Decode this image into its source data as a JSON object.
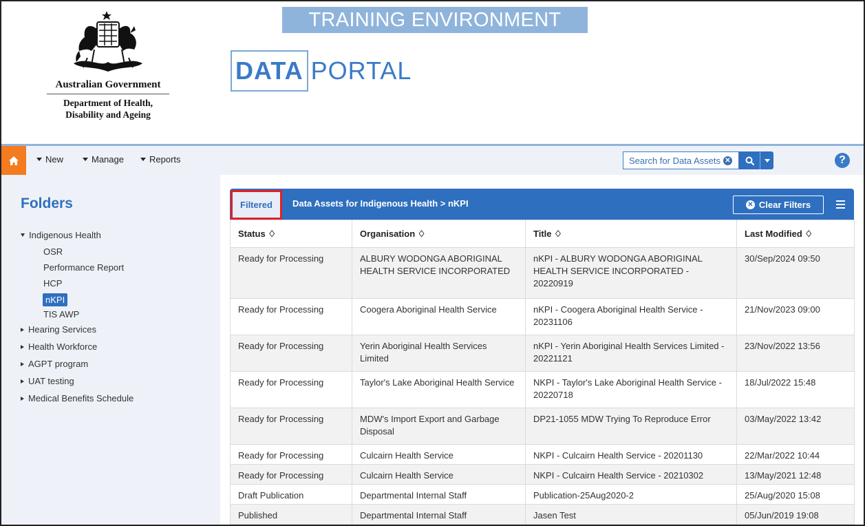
{
  "environment_banner": "TRAINING ENVIRONMENT",
  "portal_logo": {
    "bold": "DATA",
    "light": "PORTAL"
  },
  "government": {
    "name": "Australian Government",
    "department_line1": "Department of Health,",
    "department_line2": "Disability and Ageing"
  },
  "nav": {
    "home_icon": "home-icon",
    "items": [
      {
        "label": "New"
      },
      {
        "label": "Manage"
      },
      {
        "label": "Reports"
      }
    ],
    "search": {
      "placeholder": "Search for Data Assets..."
    },
    "help_label": "?"
  },
  "sidebar": {
    "title": "Folders",
    "tree": [
      {
        "label": "Indigenous Health",
        "expanded": true,
        "children": [
          "OSR",
          "Performance Report",
          "HCP",
          "nKPI",
          "TIS AWP"
        ],
        "selected": "nKPI"
      },
      {
        "label": "Hearing Services",
        "expanded": false
      },
      {
        "label": "Health Workforce",
        "expanded": false
      },
      {
        "label": "AGPT program",
        "expanded": false
      },
      {
        "label": "UAT testing",
        "expanded": false
      },
      {
        "label": "Medical Benefits Schedule",
        "expanded": false
      }
    ]
  },
  "panel": {
    "filtered_label": "Filtered",
    "title": "Data Assets for Indigenous Health > nKPI",
    "clear_filters": "Clear Filters"
  },
  "table": {
    "columns": [
      "Status ♢",
      "Organisation ♢",
      "Title ♢",
      "Last Modified ♢"
    ],
    "rows": [
      [
        "Ready for Processing",
        "ALBURY WODONGA ABORIGINAL HEALTH SERVICE INCORPORATED",
        "nKPI - ALBURY WODONGA ABORIGINAL HEALTH SERVICE INCORPORATED - 20220919",
        "30/Sep/2024 09:50"
      ],
      [
        "Ready for Processing",
        "Coogera Aboriginal Health Service",
        "nKPI - Coogera Aboriginal Health Service - 20231106",
        "21/Nov/2023 09:00"
      ],
      [
        "Ready for Processing",
        "Yerin Aboriginal Health Services Limited",
        "nKPI - Yerin Aboriginal Health Services Limited - 20221121",
        "23/Nov/2022 13:56"
      ],
      [
        "Ready for Processing",
        "Taylor's Lake Aboriginal Health Service",
        "NKPI - Taylor's Lake Aboriginal Health Service - 20220718",
        "18/Jul/2022 15:48"
      ],
      [
        "Ready for Processing",
        "MDW's Import Export and Garbage Disposal",
        "DP21-1055 MDW Trying To Reproduce Error",
        "03/May/2022 13:42"
      ],
      [
        "Ready for Processing",
        "Culcairn Health Service",
        "NKPI - Culcairn Health Service - 20201130",
        "22/Mar/2022 10:44"
      ],
      [
        "Ready for Processing",
        "Culcairn Health Service",
        "NKPI - Culcairn Health Service - 20210302",
        "13/May/2021 12:48"
      ],
      [
        "Draft Publication",
        "Departmental Internal Staff",
        "Publication-25Aug2020-2",
        "25/Aug/2020 15:08"
      ],
      [
        "Published",
        "Departmental Internal Staff",
        "Jasen Test",
        "05/Jun/2019 19:08"
      ]
    ]
  },
  "colors": {
    "brand_blue": "#2f6fbf",
    "home_orange": "#f47b20",
    "highlight_red": "#e02026"
  }
}
